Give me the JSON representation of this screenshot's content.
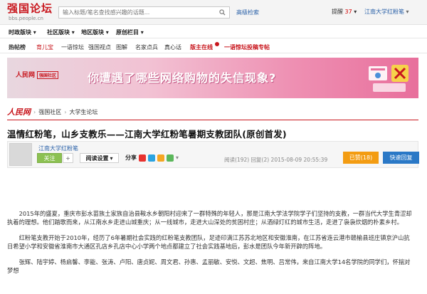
{
  "header": {
    "logo_title": "强国论坛",
    "logo_sub": "bbs.people.cn",
    "search_placeholder": "输入标题/笔名查找感兴趣的话题...",
    "adv_search": "高级检索",
    "remind_label": "提醒",
    "remind_count": "37",
    "username": "江南大学红粉笔"
  },
  "mainnav": [
    "时政版块",
    "社区版块",
    "地区版块",
    "原创栏目"
  ],
  "subnav": [
    {
      "label": "热帖榜",
      "style": "bold"
    },
    {
      "label": "育儿宝",
      "style": "red"
    },
    {
      "label": "一语惊坛",
      "style": ""
    },
    {
      "label": "强国视点",
      "style": ""
    },
    {
      "label": "图解",
      "style": ""
    },
    {
      "label": "名家点兵",
      "style": ""
    },
    {
      "label": "真心话",
      "style": ""
    },
    {
      "label": "版主在线",
      "style": "hi"
    },
    {
      "label": "一语惊坛投稿专帖",
      "style": "hi"
    }
  ],
  "banner": {
    "logo": "人民网",
    "tag": "强国社区",
    "text": "你遭遇了哪些网络购物的失信现象?"
  },
  "breadcrumb": {
    "logo": "人民网",
    "items": [
      "强国社区",
      "大学生论坛"
    ]
  },
  "post": {
    "title": "温情红粉笔，山乡支教乐——江南大学红粉笔暑期支教团队(原创首发)",
    "author": "江南大学红粉笔",
    "follow": "关注",
    "read_mode": "阅读设置",
    "share": "分享",
    "meta": "阅读(192) 回复(2) 2015-08-09 20:55:39",
    "praise": "已赞(18)",
    "reply": "快速回复",
    "paragraphs": [
      "2015年的盛夏，重庆市彭水苗族土家族自治县鞍水乡朝阳村迎来了一群特殊的年轻人，那是江南大学法学院学子们坚持的支教，一群当代大学生青涩却执着的理想。他们踏歌而来，从江南水乡走进山城重庆；从一线城市，走进大山深处的贫困村庄；从酒绿灯红的城市生活，走进了袅袅炊烟的朴素乡村。",
      "红粉笔支教开始于2010年，经历了6年暑期社会实践的红粉笔支教团队，足迹印满江苏苏北地区和安徽淮南，在江苏省连云港市赣榆县班庄镇京沪山抗日希望小学和安徽省淮南市大通区孔店乡孔店中心小学两个地点都建立了社会实践基地后，彭水是团队今年新开辟的阵地。",
      "张辉、陆宇婷、杨启馨、李能、张涛、卢阳、唐贞妮、周文君、孙惠、孟丽敏、安悦、文超、焦明、吕常伟，来自江南大学14名学院的同学们，怀揣对梦想"
    ]
  },
  "colors": {
    "brand_red": "#c8161d",
    "link_blue": "#2a61a8",
    "praise_orange": "#f39c12",
    "reply_blue": "#2a78c6",
    "follow_green": "#8cc152"
  }
}
